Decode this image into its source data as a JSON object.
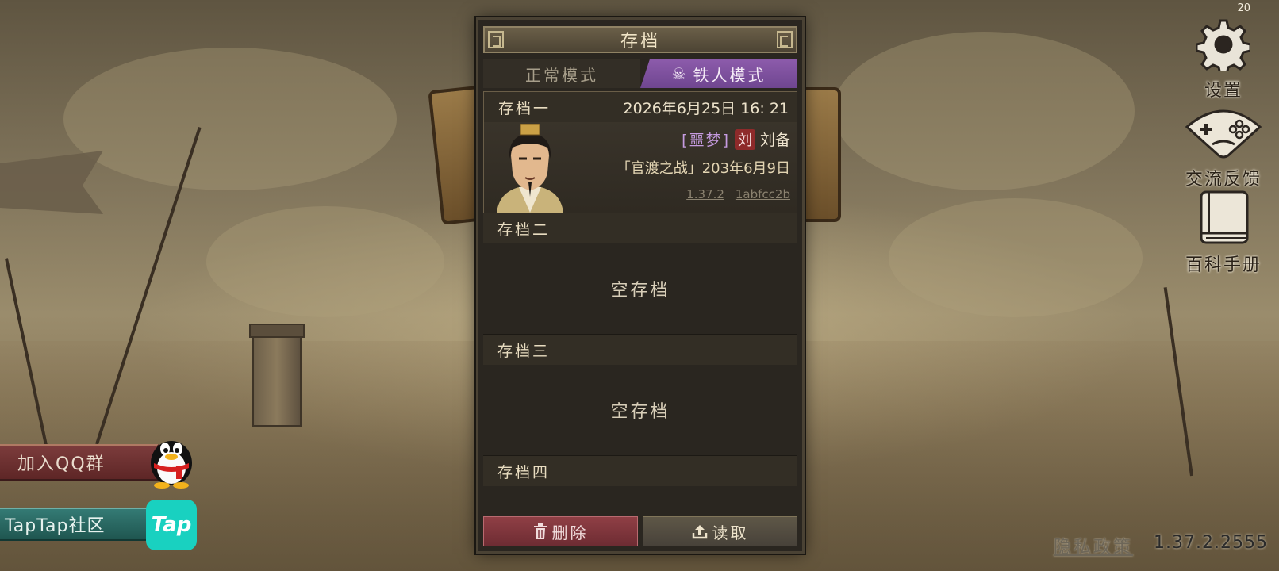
{
  "fps_counter": "20",
  "side_menu": {
    "settings_label": "设置",
    "feedback_label": "交流反馈",
    "encyclopedia_label": "百科手册"
  },
  "left_links": {
    "qq_label": "加入QQ群",
    "taptap_label": "TapTap社区",
    "taptap_logo_text": "Tap"
  },
  "footer": {
    "privacy_label": "隐私政策",
    "version": "1.37.2.2555"
  },
  "panel": {
    "title": "存档",
    "tabs": [
      {
        "label": "正常模式",
        "active": false
      },
      {
        "label": "铁人模式",
        "active": true,
        "icon": "skull-crossbones-icon"
      }
    ],
    "slots": [
      {
        "name": "存档一",
        "timestamp": "2026年6月25日 16: 21",
        "difficulty": "[噩梦]",
        "faction_badge": "刘",
        "lord": "刘备",
        "scenario": "「官渡之战」203年6月9日",
        "game_version": "1.37.2",
        "build_hash": "1abfcc2b"
      },
      {
        "name": "存档二",
        "empty_label": "空存档"
      },
      {
        "name": "存档三",
        "empty_label": "空存档"
      },
      {
        "name": "存档四"
      }
    ],
    "delete_label": "删除",
    "load_label": "读取"
  },
  "colors": {
    "iron_tab": "#7b4f9c",
    "delete_button": "#7e353c",
    "load_button": "#534c40",
    "qq_button": "#6d3232",
    "taptap_button": "#2a6a64"
  }
}
